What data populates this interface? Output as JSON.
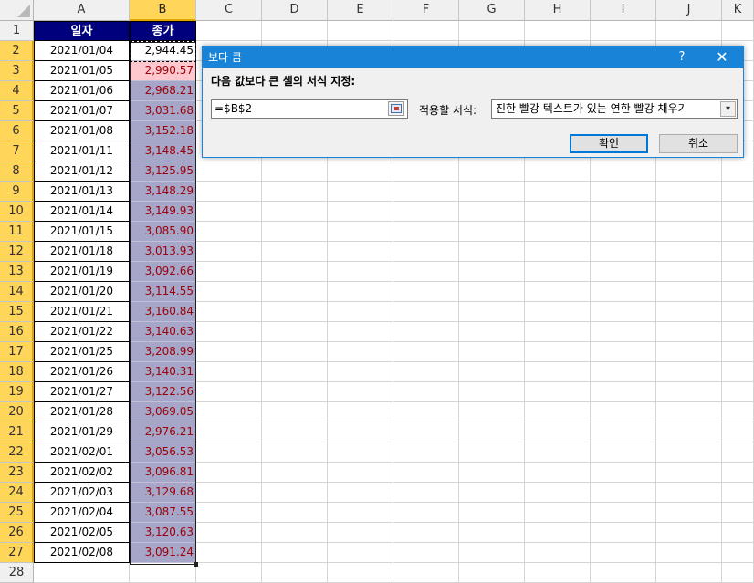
{
  "columns": [
    "A",
    "B",
    "C",
    "D",
    "E",
    "F",
    "G",
    "H",
    "I",
    "J",
    "K"
  ],
  "header_row": {
    "date_label": "일자",
    "value_label": "종가"
  },
  "rows": [
    {
      "date": "2021/01/04",
      "value": "2,944.45"
    },
    {
      "date": "2021/01/05",
      "value": "2,990.57"
    },
    {
      "date": "2021/01/06",
      "value": "2,968.21"
    },
    {
      "date": "2021/01/07",
      "value": "3,031.68"
    },
    {
      "date": "2021/01/08",
      "value": "3,152.18"
    },
    {
      "date": "2021/01/11",
      "value": "3,148.45"
    },
    {
      "date": "2021/01/12",
      "value": "3,125.95"
    },
    {
      "date": "2021/01/13",
      "value": "3,148.29"
    },
    {
      "date": "2021/01/14",
      "value": "3,149.93"
    },
    {
      "date": "2021/01/15",
      "value": "3,085.90"
    },
    {
      "date": "2021/01/18",
      "value": "3,013.93"
    },
    {
      "date": "2021/01/19",
      "value": "3,092.66"
    },
    {
      "date": "2021/01/20",
      "value": "3,114.55"
    },
    {
      "date": "2021/01/21",
      "value": "3,160.84"
    },
    {
      "date": "2021/01/22",
      "value": "3,140.63"
    },
    {
      "date": "2021/01/25",
      "value": "3,208.99"
    },
    {
      "date": "2021/01/26",
      "value": "3,140.31"
    },
    {
      "date": "2021/01/27",
      "value": "3,122.56"
    },
    {
      "date": "2021/01/28",
      "value": "3,069.05"
    },
    {
      "date": "2021/01/29",
      "value": "2,976.21"
    },
    {
      "date": "2021/02/01",
      "value": "3,056.53"
    },
    {
      "date": "2021/02/02",
      "value": "3,096.81"
    },
    {
      "date": "2021/02/03",
      "value": "3,129.68"
    },
    {
      "date": "2021/02/04",
      "value": "3,087.55"
    },
    {
      "date": "2021/02/05",
      "value": "3,120.63"
    },
    {
      "date": "2021/02/08",
      "value": "3,091.24"
    }
  ],
  "row_numbers": [
    "1",
    "2",
    "3",
    "4",
    "5",
    "6",
    "7",
    "8",
    "9",
    "10",
    "11",
    "12",
    "13",
    "14",
    "15",
    "16",
    "17",
    "18",
    "19",
    "20",
    "21",
    "22",
    "23",
    "24",
    "25",
    "26",
    "27",
    "28"
  ],
  "dialog": {
    "title": "보다 큼",
    "help_label": "?",
    "close_label": "✕",
    "prompt": "다음 값보다 큰 셀의 서식 지정:",
    "reference_value": "=$B$2",
    "format_label": "적용할 서식:",
    "format_selected": "진한 빨강 텍스트가 있는 연한 빨강 채우기",
    "ok_label": "확인",
    "cancel_label": "취소"
  },
  "colors": {
    "header_fill": "#00007d",
    "highlight_fill": "#a6a6c8",
    "highlight_text": "#9c0006",
    "preview_fill": "#ffc7ce",
    "selected_header": "#ffd55a",
    "dialog_accent": "#1883d7"
  }
}
